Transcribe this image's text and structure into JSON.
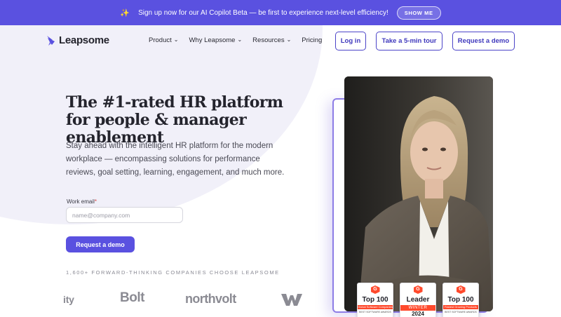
{
  "announcement": {
    "text": "Sign up now for our AI Copilot Beta — be first to experience next-level efficiency!",
    "button_label": "SHOW ME",
    "icon": "sparkles-icon"
  },
  "brand": {
    "name": "Leapsome",
    "color": "#5a51e0"
  },
  "nav": {
    "items": [
      {
        "label": "Product",
        "has_dropdown": true
      },
      {
        "label": "Why Leapsome",
        "has_dropdown": true
      },
      {
        "label": "Resources",
        "has_dropdown": true
      },
      {
        "label": "Pricing",
        "has_dropdown": false
      }
    ],
    "login_label": "Log in",
    "tour_label": "Take a 5-min tour",
    "demo_label": "Request a demo",
    "dropdown_icon": "chevron-down-icon"
  },
  "hero": {
    "headline": "The #1-rated HR platform for people & manager enablement",
    "subcopy": "Stay ahead with the intelligent HR platform for the modern workplace — encompassing solutions for performance reviews, goal setting, learning, engagement, and much more.",
    "email_label": "Work email",
    "email_required_mark": "*",
    "email_placeholder": "name@company.com",
    "cta_label": "Request a demo",
    "companies_caption": "1,600+ FORWARD-THINKING COMPANIES CHOOSE LEAPSOME",
    "company_logos": [
      "ity",
      "Bolt",
      "northvolt"
    ],
    "company_logo_icons": [
      "wolt-w-logo"
    ]
  },
  "badges": [
    {
      "title": "Top 100",
      "band": "Global Software Companies",
      "sub": "BEST SOFTWARE AWARDS",
      "year": ""
    },
    {
      "title": "Leader",
      "band": "WINTER",
      "sub": "",
      "year": "2024"
    },
    {
      "title": "Top 100",
      "band": "Fastest Growing Products",
      "sub": "BEST SOFTWARE AWARDS",
      "year": ""
    }
  ],
  "colors": {
    "accent": "#5a51e0",
    "nav_button_border": "#4b44c8",
    "g2_red": "#ff492c",
    "hero_bg": "#f1f0f9"
  }
}
